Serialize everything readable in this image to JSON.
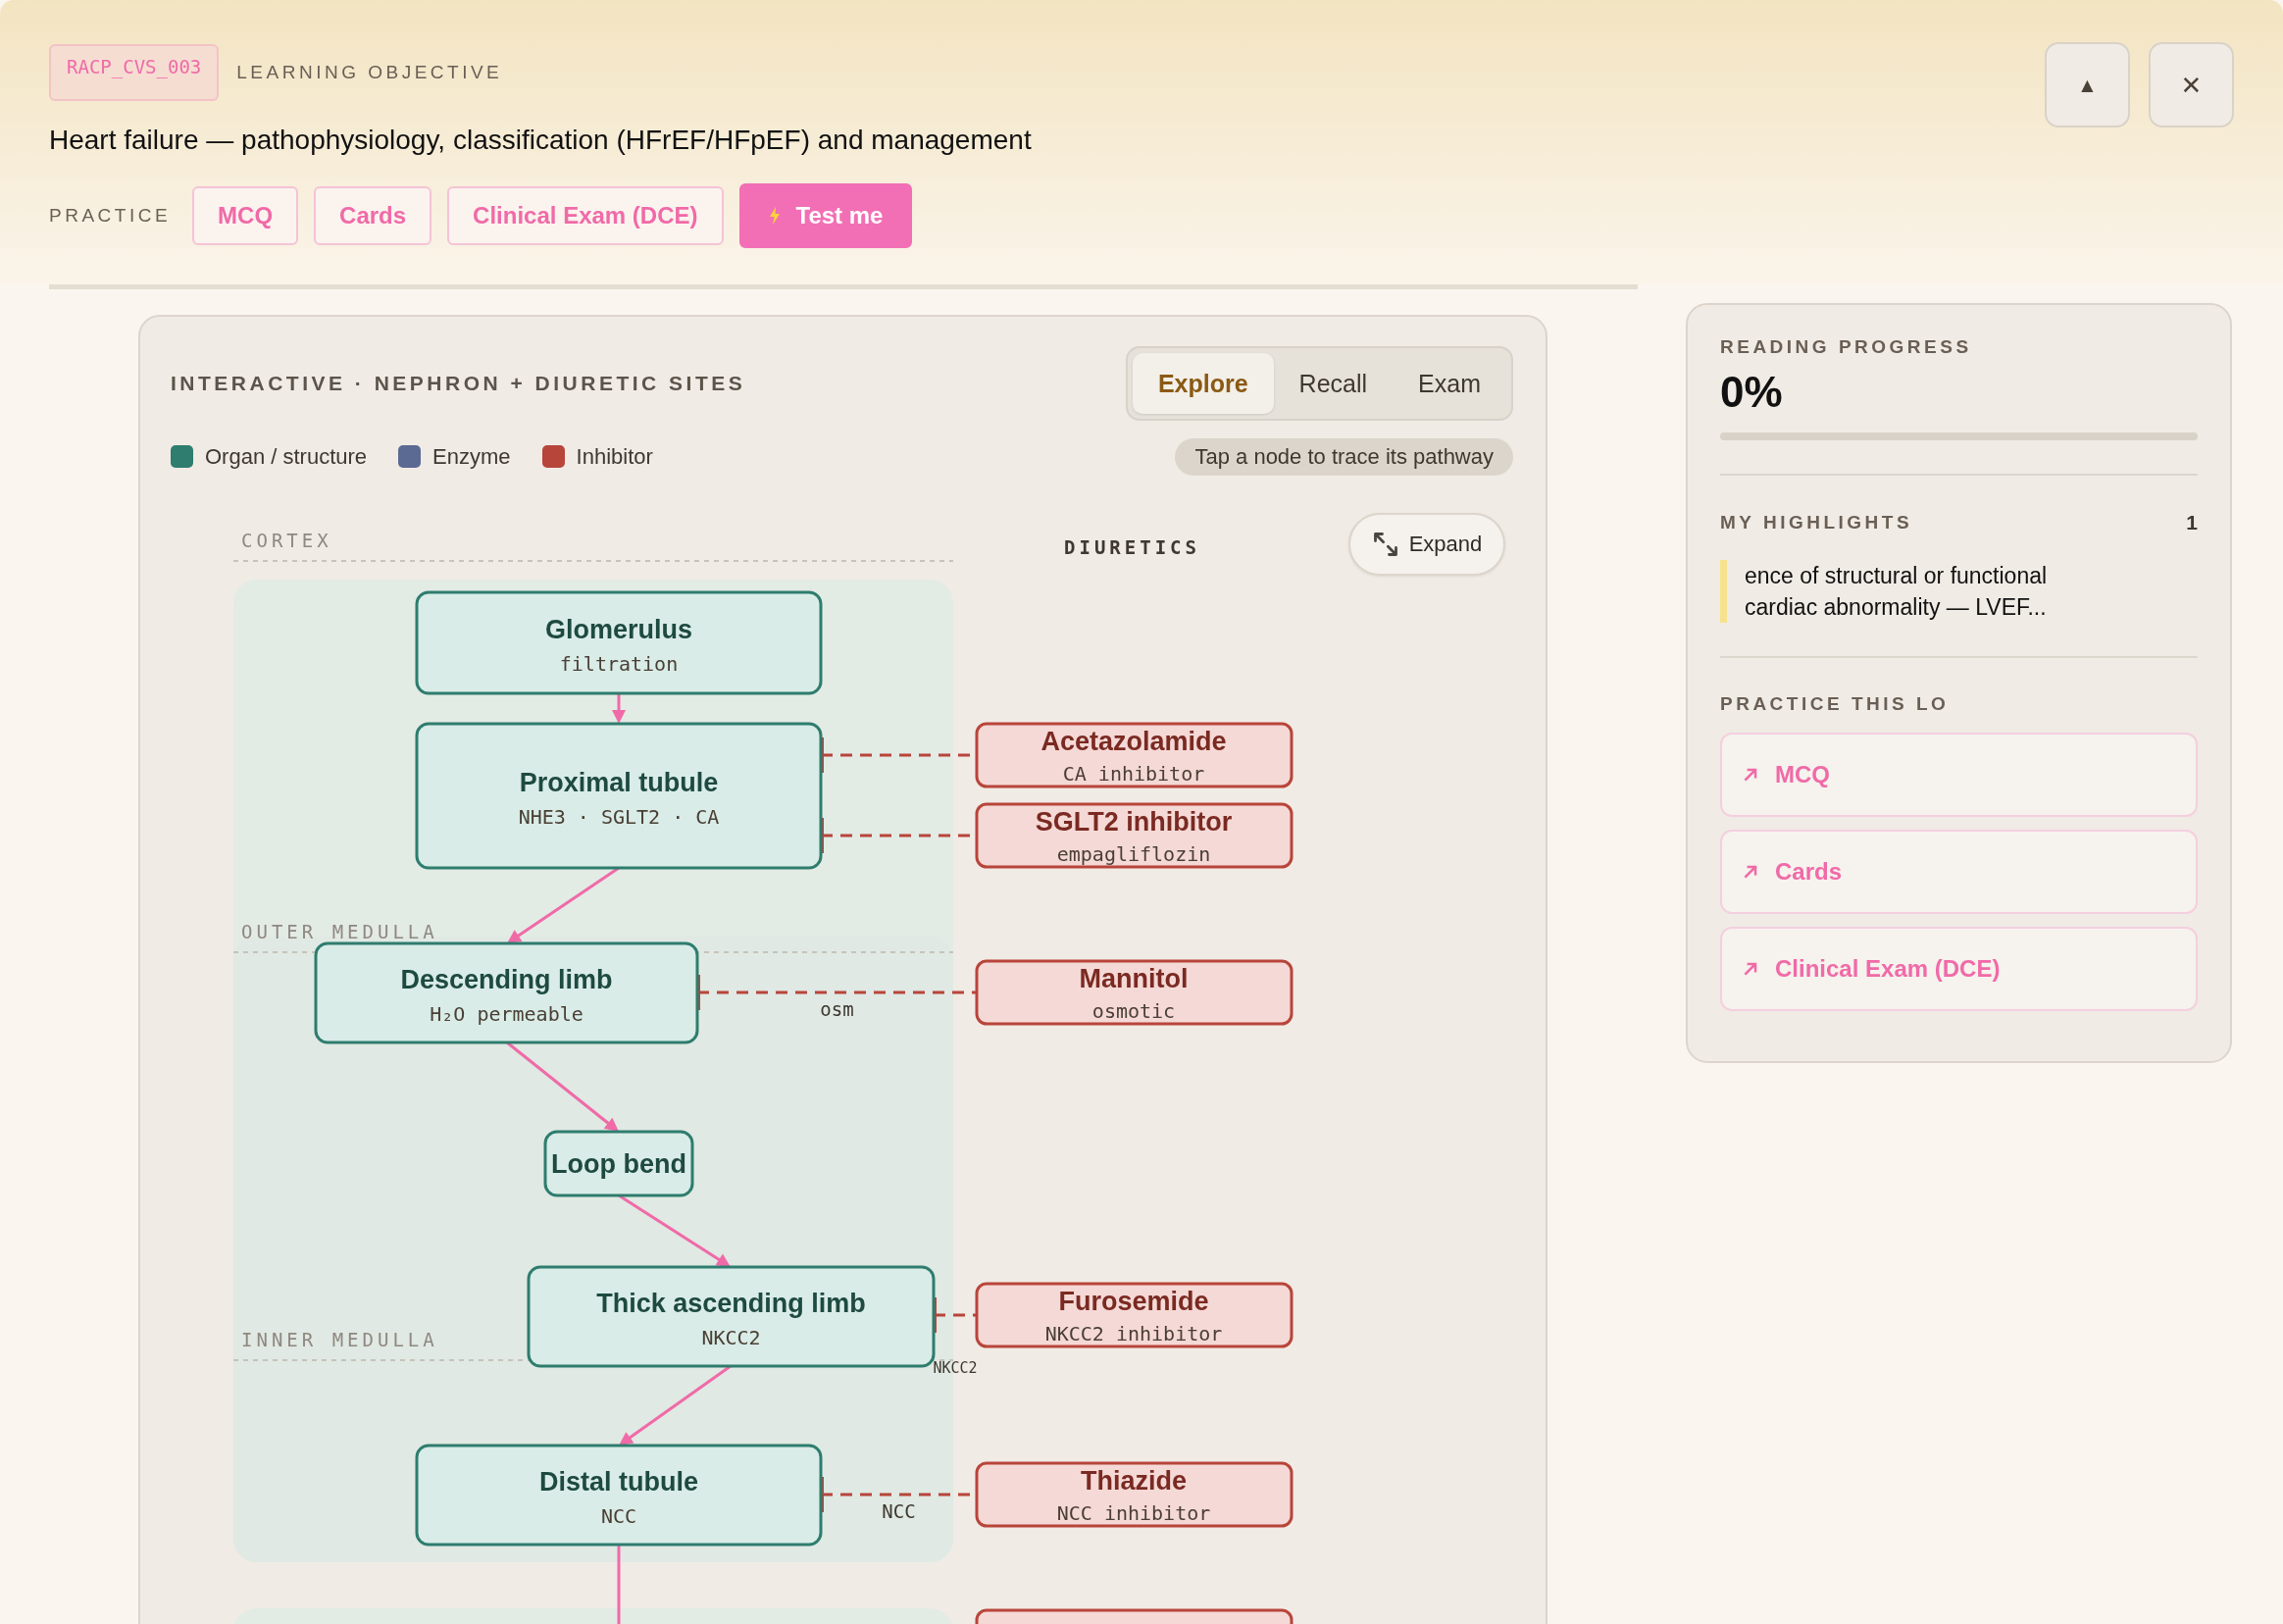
{
  "header": {
    "code_tag": "RACP_CVS_003",
    "eyebrow": "LEARNING OBJECTIVE",
    "title": "Heart failure — pathophysiology, classification (HFrEF/HFpEF) and management",
    "practice_label": "PRACTICE",
    "practice_buttons": [
      {
        "label": "MCQ",
        "kind": "outline"
      },
      {
        "label": "Cards",
        "kind": "outline"
      },
      {
        "label": "Clinical Exam (DCE)",
        "kind": "outline"
      },
      {
        "label": "Test me",
        "kind": "primary"
      }
    ],
    "window_buttons": [
      {
        "glyph": "▲",
        "kind": "collapse"
      },
      {
        "glyph": "✕",
        "kind": "close"
      }
    ]
  },
  "diagram": {
    "title": "INTERACTIVE · NEPHRON + DIURETIC SITES",
    "modes": [
      {
        "label": "Explore",
        "selected": true
      },
      {
        "label": "Recall",
        "selected": false
      },
      {
        "label": "Exam",
        "selected": false
      }
    ],
    "legend": [
      {
        "label": "Organ / structure",
        "color": "#2e7d6e"
      },
      {
        "label": "Enzyme",
        "color": "#5b6a93"
      },
      {
        "label": "Inhibitor",
        "color": "#b8453a"
      }
    ],
    "hint": "Tap a node to trace its pathway",
    "expand_label": "Expand",
    "column_label": "DIURETICS",
    "zones": [
      {
        "label": "CORTEX"
      },
      {
        "label": "OUTER MEDULLA"
      },
      {
        "label": "INNER MEDULLA"
      }
    ],
    "nodes": [
      {
        "name": "Glomerulus",
        "detail": "filtration"
      },
      {
        "name": "Proximal tubule",
        "detail": "NHE3 · SGLT2 · CA"
      },
      {
        "name": "Descending limb",
        "detail": "H₂O permeable"
      },
      {
        "name": "Loop bend"
      },
      {
        "name": "Thick ascending limb",
        "detail": "NKCC2"
      },
      {
        "name": "Distal tubule",
        "detail": "NCC"
      }
    ],
    "drugs": [
      {
        "kind": "full",
        "name": "Acetazolamide",
        "detail": "CA inhibitor"
      },
      {
        "kind": "full",
        "name": "SGLT2 inhibitor",
        "detail": "empagliflozin"
      },
      {
        "kind": "full",
        "name": "Mannitol",
        "detail": "osmotic",
        "site_label": "osm"
      },
      {
        "kind": "full",
        "name": "Furosemide",
        "detail": "NKCC2 inhibitor",
        "site_label": "NKCC2"
      },
      {
        "kind": "full",
        "name": "Thiazide",
        "detail": "NCC inhibitor",
        "site_label": "NCC"
      },
      {
        "kind": "cut_off"
      }
    ]
  },
  "sidebar": {
    "progress_label": "READING PROGRESS",
    "progress_value": "0%",
    "progress": {
      "level": 0
    },
    "highlights_label": "MY HIGHLIGHTS",
    "highlights_count": "1",
    "highlights": [
      "ence of structural or functional cardiac abnormality — LVEF..."
    ],
    "practice_label": "PRACTICE THIS LO",
    "practice_links": [
      "MCQ",
      "Cards",
      "Clinical Exam (DCE)"
    ]
  }
}
